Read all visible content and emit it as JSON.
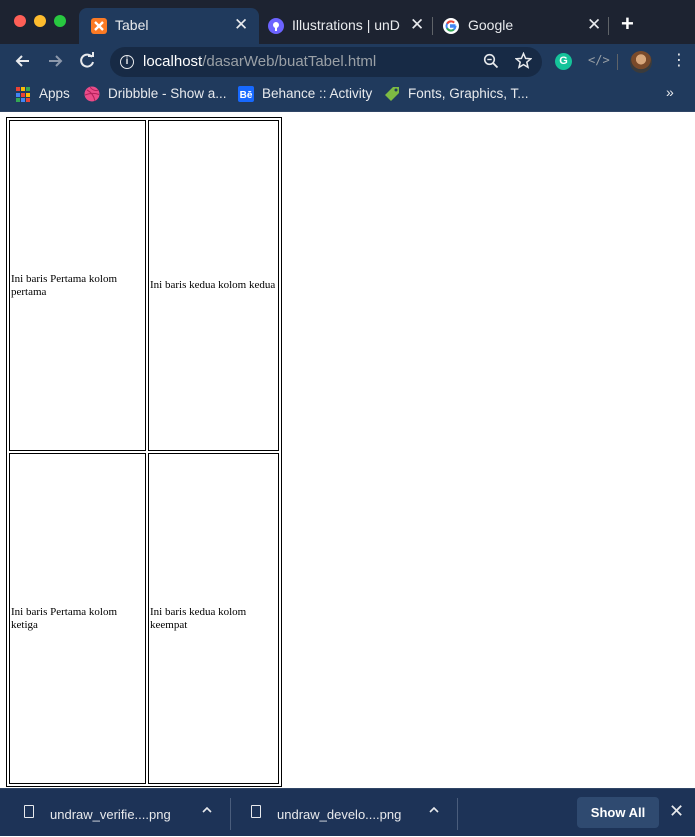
{
  "tabs": [
    {
      "title": "Tabel",
      "icon": "xampp-icon"
    },
    {
      "title": "Illustrations | unDraw",
      "icon": "undraw-icon"
    },
    {
      "title": "Google",
      "icon": "google-icon"
    }
  ],
  "new_tab_symbol": "+",
  "close_symbol": "✕",
  "url": {
    "host": "localhost",
    "path": "/dasarWeb/buatTabel.html"
  },
  "bookmarks": [
    {
      "label": "Apps",
      "icon": "apps-grid-icon"
    },
    {
      "label": "Dribbble - Show a...",
      "icon": "dribbble-icon"
    },
    {
      "label": "Behance :: Activity",
      "icon": "behance-icon"
    },
    {
      "label": "Fonts, Graphics, T...",
      "icon": "tag-icon"
    }
  ],
  "bookmarks_overflow": "»",
  "table": {
    "rows": [
      [
        "Ini baris Pertama kolom pertama",
        "Ini baris kedua kolom kedua"
      ],
      [
        "Ini baris Pertama kolom ketiga",
        "Ini baris kedua kolom keempat"
      ]
    ]
  },
  "downloads": [
    {
      "filename": "undraw_verifie....png"
    },
    {
      "filename": "undraw_develo....png"
    }
  ],
  "show_all_label": "Show All",
  "colors": {
    "tabstrip": "#1d2331",
    "toolbar": "#203a5d",
    "shelf": "#1d3357"
  }
}
